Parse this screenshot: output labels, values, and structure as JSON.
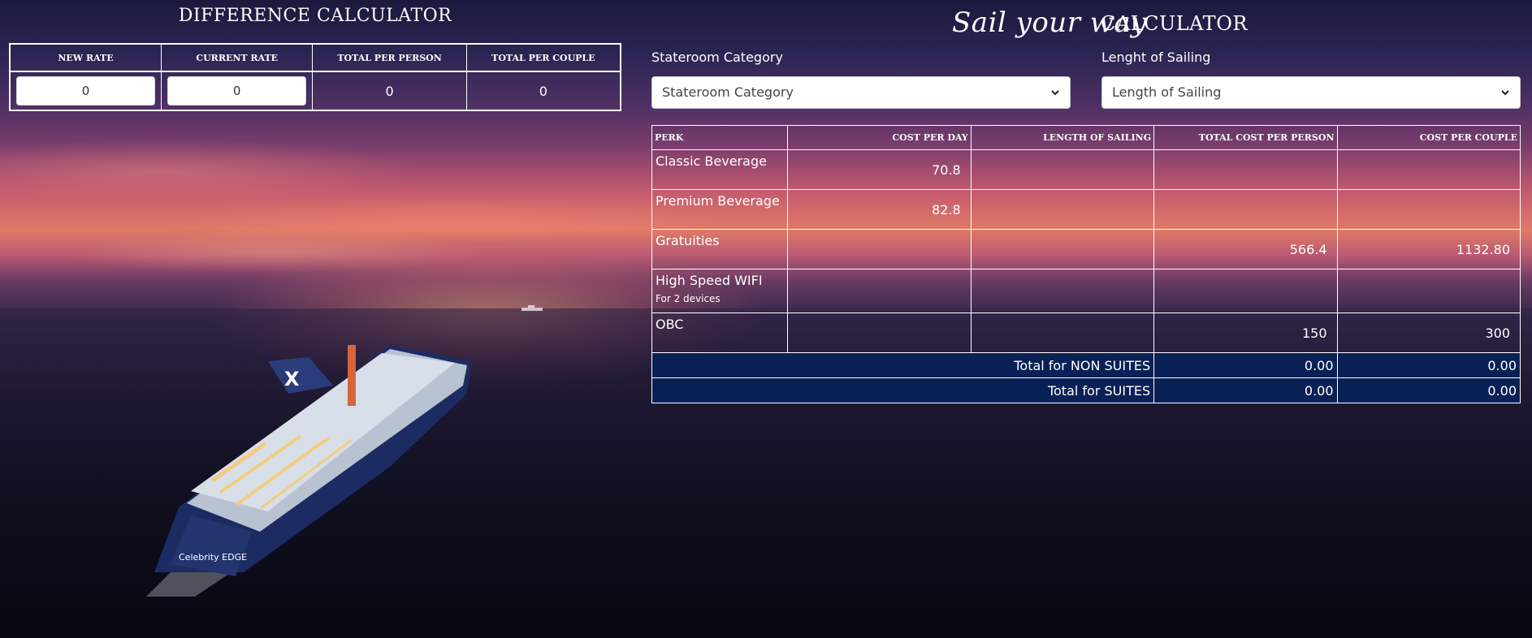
{
  "difference_calculator": {
    "title": "DIFFERENCE CALCULATOR",
    "headers": [
      "NEW RATE",
      "CURRENT RATE",
      "TOTAL PER PERSON",
      "TOTAL PER COUPLE"
    ],
    "new_rate_value": "0",
    "current_rate_value": "0",
    "total_per_person": "0",
    "total_per_couple": "0"
  },
  "sail_calculator": {
    "script_title": "Sail your way",
    "title": "CALCULATOR",
    "stateroom_label": "Stateroom Category",
    "stateroom_selected": "Stateroom Category",
    "length_label": "Lenght of Sailing",
    "length_selected": "Length of Sailing",
    "table_headers": [
      "PERK",
      "COST PER DAY",
      "LENGTH OF SAILING",
      "TOTAL COST PER PERSON",
      "COST PER COUPLE"
    ],
    "rows": [
      {
        "perk": "Classic Beverage",
        "note": "",
        "cost_per_day": "70.8",
        "length": "",
        "total_per_person": "",
        "per_couple": ""
      },
      {
        "perk": "Premium Beverage",
        "note": "",
        "cost_per_day": "82.8",
        "length": "",
        "total_per_person": "",
        "per_couple": ""
      },
      {
        "perk": "Gratuities",
        "note": "",
        "cost_per_day": "",
        "length": "",
        "total_per_person": "566.4",
        "per_couple": "1132.80"
      },
      {
        "perk": "High Speed WIFI",
        "note": "For 2 devices",
        "cost_per_day": "",
        "length": "",
        "total_per_person": "",
        "per_couple": ""
      },
      {
        "perk": "OBC",
        "note": "",
        "cost_per_day": "",
        "length": "",
        "total_per_person": "150",
        "per_couple": "300"
      }
    ],
    "totals": [
      {
        "label": "Total for NON SUITES",
        "per_person": "0.00",
        "per_couple": "0.00"
      },
      {
        "label": "Total for SUITES",
        "per_person": "0.00",
        "per_couple": "0.00"
      }
    ]
  },
  "background": {
    "ship_hull_text": "Celebrity EDGE"
  }
}
